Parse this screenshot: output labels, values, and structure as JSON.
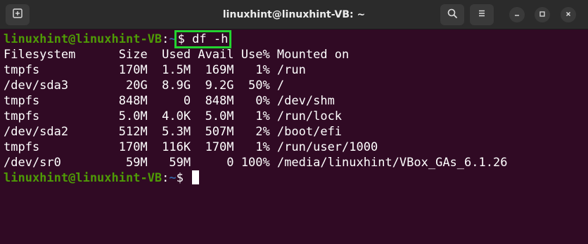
{
  "window": {
    "title": "linuxhint@linuxhint-VB: ~",
    "buttons": {
      "new_tab_icon": "new-tab-icon",
      "search_icon": "search-icon",
      "menu_icon": "hamburger-menu-icon",
      "minimize_icon": "minimize-icon",
      "maximize_icon": "maximize-icon",
      "close_icon": "close-icon"
    }
  },
  "terminal": {
    "prompt_user_host": "linuxhint@linuxhint-VB",
    "prompt_sep": ":",
    "prompt_path": "~",
    "command": "$ df -h",
    "prompt_dollar": "$ ",
    "output_lines": [
      "Filesystem      Size  Used Avail Use% Mounted on",
      "tmpfs           170M  1.5M  169M   1% /run",
      "/dev/sda3        20G  8.9G  9.2G  50% /",
      "tmpfs           848M     0  848M   0% /dev/shm",
      "tmpfs           5.0M  4.0K  5.0M   1% /run/lock",
      "/dev/sda2       512M  5.3M  507M   2% /boot/efi",
      "tmpfs           170M  116K  170M   1% /run/user/1000",
      "/dev/sr0         59M   59M     0 100% /media/linuxhint/VBox_GAs_6.1.26"
    ]
  },
  "colors": {
    "terminal_bg": "#300a24",
    "prompt_user": "#4e9a06",
    "prompt_path": "#3465a4",
    "highlight_box": "#23d330",
    "titlebar_bg": "#2b2b2b"
  }
}
